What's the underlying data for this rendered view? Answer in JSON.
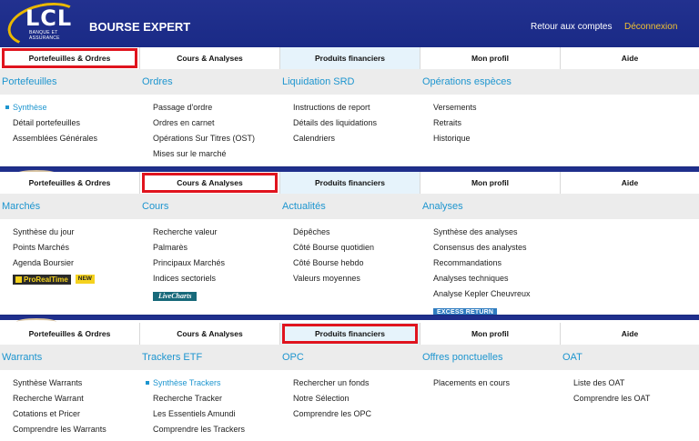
{
  "header": {
    "logo_text": "LCL",
    "logo_subtitle": "BANQUE ET ASSURANCE",
    "brand": "BOURSE EXPERT",
    "accounts_link": "Retour aux comptes",
    "logout_link": "Déconnexion",
    "logout_color": "#f2c230"
  },
  "panels": [
    {
      "tabs": [
        "Portefeuilles & Ordres",
        "Cours & Analyses",
        "Produits financiers",
        "Mon profil",
        "Aide"
      ],
      "selected_tab": 0,
      "columns": [
        {
          "title": "Portefeuilles",
          "items": [
            "Synthèse",
            "Détail portefeuilles",
            "Assemblées Générales"
          ]
        },
        {
          "title": "Ordres",
          "items": [
            "Passage d'ordre",
            "Ordres en carnet",
            "Opérations Sur Titres (OST)",
            "Mises sur le marché"
          ]
        },
        {
          "title": "Liquidation SRD",
          "items": [
            "Instructions de report",
            "Détails des liquidations",
            "Calendriers"
          ]
        },
        {
          "title": "Opérations espèces",
          "items": [
            "Versements",
            "Retraits",
            "Historique"
          ]
        }
      ]
    },
    {
      "tabs": [
        "Portefeuilles & Ordres",
        "Cours & Analyses",
        "Produits financiers",
        "Mon profil",
        "Aide"
      ],
      "selected_tab": 1,
      "columns": [
        {
          "title": "Marchés",
          "items": [
            "Synthèse du jour",
            "Points Marchés",
            "Agenda Boursier"
          ],
          "badge": "ProRealTime",
          "badge_new": "NEW"
        },
        {
          "title": "Cours",
          "items": [
            "Recherche valeur",
            "Palmarès",
            "Principaux Marchés",
            "Indices sectoriels"
          ],
          "badge": "LiveCharts"
        },
        {
          "title": "Actualités",
          "items": [
            "Dépêches",
            "Côté Bourse quotidien",
            "Côté Bourse hebdo",
            "Valeurs moyennes"
          ]
        },
        {
          "title": "Analyses",
          "items": [
            "Synthèse des analyses",
            "Consensus des analystes",
            "Recommandations",
            "Analyses techniques",
            "Analyse Kepler Cheuvreux"
          ],
          "badge": "EXCESS RETURN"
        }
      ]
    },
    {
      "tabs": [
        "Portefeuilles & Ordres",
        "Cours & Analyses",
        "Produits financiers",
        "Mon profil",
        "Aide"
      ],
      "selected_tab": 2,
      "columns": [
        {
          "title": "Warrants",
          "items": [
            "Synthèse Warrants",
            "Recherche Warrant",
            "Cotations et Pricer",
            "Comprendre les Warrants"
          ]
        },
        {
          "title": "Trackers ETF",
          "items": [
            "Synthèse Trackers",
            "Recherche Tracker",
            "Les Essentiels Amundi",
            "Comprendre les Trackers"
          ]
        },
        {
          "title": "OPC",
          "items": [
            "Rechercher un fonds",
            "Notre Sélection",
            "Comprendre les OPC"
          ]
        },
        {
          "title": "Offres ponctuelles",
          "items": [
            "Placements en cours"
          ]
        },
        {
          "title": "OAT",
          "items": [
            "Liste des OAT",
            "Comprendre les OAT"
          ]
        }
      ]
    }
  ],
  "colors": {
    "header_bg": "#1f2f8c",
    "link_blue": "#1d95cf",
    "selected_outline": "#e0141e",
    "highlight_tab": "#e6f3fb"
  }
}
